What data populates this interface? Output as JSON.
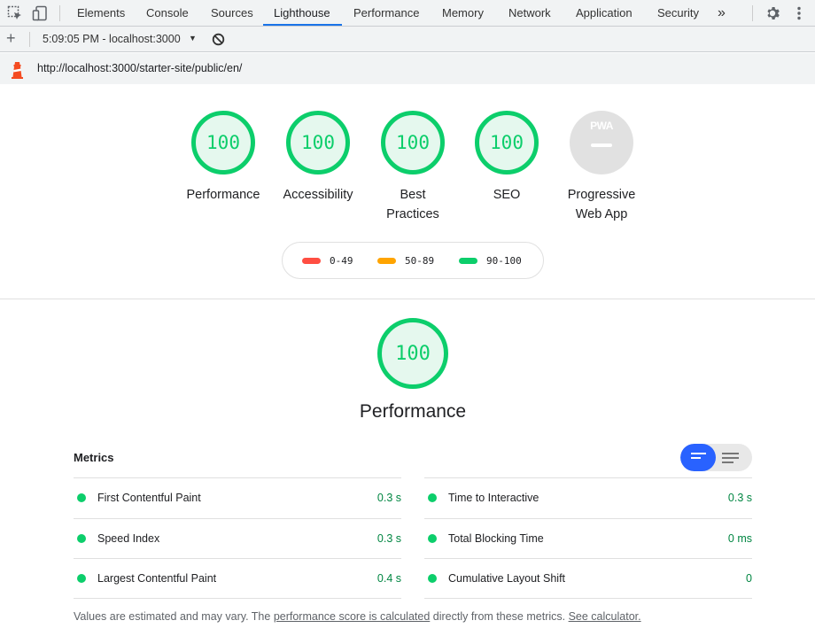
{
  "devtools": {
    "tabs": [
      "Elements",
      "Console",
      "Sources",
      "Lighthouse",
      "Performance",
      "Memory",
      "Network",
      "Application",
      "Security"
    ],
    "active_tab": "Lighthouse",
    "more_icon": "»"
  },
  "toolbar": {
    "report_label": "5:09:05 PM - localhost:3000",
    "dropdown_icon": "▼"
  },
  "url_row": {
    "url": "http://localhost:3000/starter-site/public/en/"
  },
  "colors": {
    "pass": "#0cce6b",
    "pass_bg": "#e5f8ee",
    "average": "#ffa400",
    "fail": "#ff4e42",
    "accent": "#1a73e8"
  },
  "gauges": [
    {
      "score": "100",
      "label": "Performance"
    },
    {
      "score": "100",
      "label": "Accessibility"
    },
    {
      "score": "100",
      "label": "Best Practices"
    },
    {
      "score": "100",
      "label": "SEO"
    },
    {
      "score": "",
      "label": "Progressive Web App",
      "badge": "PWA"
    }
  ],
  "legend": [
    {
      "range": "0-49",
      "color": "#ff4e42"
    },
    {
      "range": "50-89",
      "color": "#ffa400"
    },
    {
      "range": "90-100",
      "color": "#0cce6b"
    }
  ],
  "performance": {
    "score": "100",
    "title": "Performance"
  },
  "metrics": {
    "title": "Metrics",
    "left": [
      {
        "name": "First Contentful Paint",
        "value": "0.3 s"
      },
      {
        "name": "Speed Index",
        "value": "0.3 s"
      },
      {
        "name": "Largest Contentful Paint",
        "value": "0.4 s"
      }
    ],
    "right": [
      {
        "name": "Time to Interactive",
        "value": "0.3 s"
      },
      {
        "name": "Total Blocking Time",
        "value": "0 ms"
      },
      {
        "name": "Cumulative Layout Shift",
        "value": "0"
      }
    ]
  },
  "footnote": {
    "prefix": "Values are estimated and may vary. The ",
    "link1": "performance score is calculated",
    "middle": " directly from these metrics. ",
    "link2": "See calculator."
  }
}
